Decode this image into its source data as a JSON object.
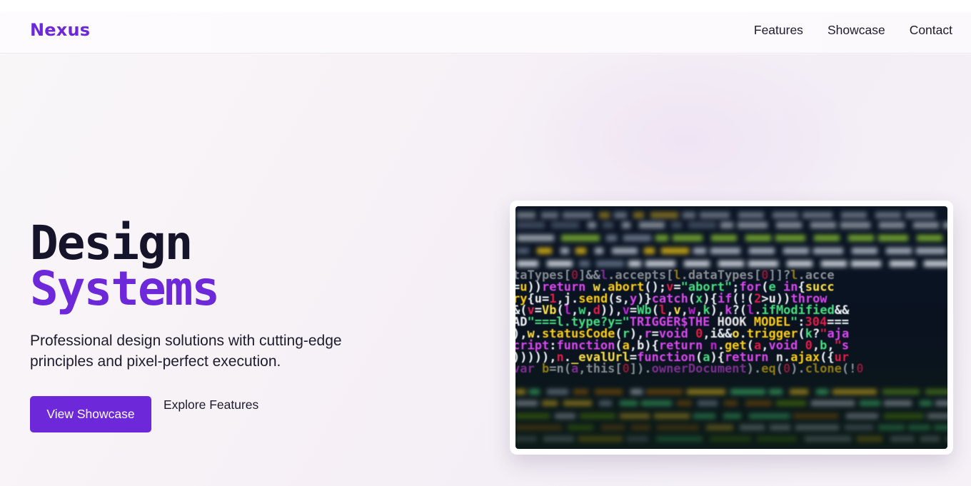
{
  "brand": {
    "logo_text": "Nexus",
    "accent_color": "#6d28d9"
  },
  "nav": {
    "items": [
      {
        "label": "Features"
      },
      {
        "label": "Showcase"
      },
      {
        "label": "Contact"
      }
    ]
  },
  "hero": {
    "title_line1": "Design",
    "title_line2": "Systems",
    "subtitle": "Professional design solutions with cutting-edge principles and pixel-perfect execution.",
    "primary_button": "View Showcase",
    "secondary_link": "Explore Features",
    "image": {
      "description_icon": "code-screen-image",
      "code_lines": [
        "taTypes[0]&&l.accepts[l.dataTypes[0]]?l.acce",
        "=u))return w.abort();v=\"abort\";for(e in{succ",
        "ry{u=1,j.send(s,y)}catch(x){if(!(2>u))throw",
        "&(v=Vb(l,w,d)),v=Wb(l,v,w,k),k?(l.ifModified&&",
        "AD\"===l.type?y=\"TRIGGER$THE HOOK MODEL\":304===",
        "),w.statusCode(r),r=void 0,i&&o.trigger(k?\"aja",
        "cript:function(a,b){return n.get(a,void 0,b,\"s",
        "))))),n._evalUrl=function(a){return n.ajax({ur",
        "var b=n(a,this[0]).ownerDocument).eq(0).clone(!0"
      ]
    }
  }
}
